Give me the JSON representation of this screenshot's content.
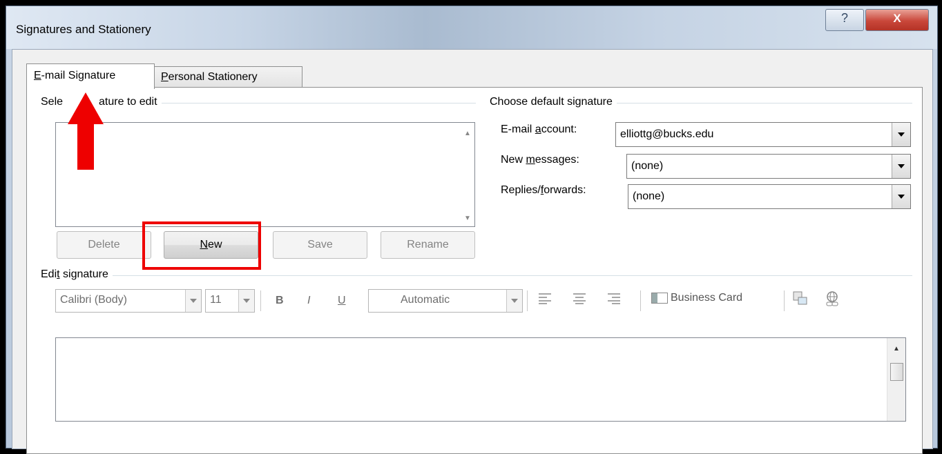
{
  "window": {
    "title": "Signatures and Stationery",
    "help_label": "?",
    "close_label": "X"
  },
  "tabs": [
    {
      "label_underlined": "E",
      "label_rest": "-mail Signature",
      "active": true
    },
    {
      "label_underlined": "P",
      "label_rest": "ersonal Stationery",
      "active": false
    }
  ],
  "select_section": {
    "title_prefix": "Sele",
    "title_suffix": "ature to edit"
  },
  "signature_buttons": {
    "delete": "Delete",
    "new_underlined": "N",
    "new_rest": "ew",
    "save": "Save",
    "rename": "Rename"
  },
  "default_section": {
    "title": "Choose default signature",
    "email_account_label_pre": "E-mail ",
    "email_account_label_u": "a",
    "email_account_label_post": "ccount:",
    "email_account_value": "elliottg@bucks.edu",
    "new_messages_label_pre": "New ",
    "new_messages_label_u": "m",
    "new_messages_label_post": "essages:",
    "new_messages_value": "(none)",
    "replies_label_pre": "Replies/",
    "replies_label_u": "f",
    "replies_label_post": "orwards:",
    "replies_value": "(none)"
  },
  "edit_section": {
    "title_pre": "Edi",
    "title_u": "t",
    "title_post": " signature"
  },
  "toolbar": {
    "font": "Calibri (Body)",
    "size": "11",
    "bold": "B",
    "italic": "I",
    "underline": "U",
    "color": "Automatic",
    "business_card": "Business Card"
  },
  "annotations": {
    "highlight_color": "#ee0000"
  }
}
